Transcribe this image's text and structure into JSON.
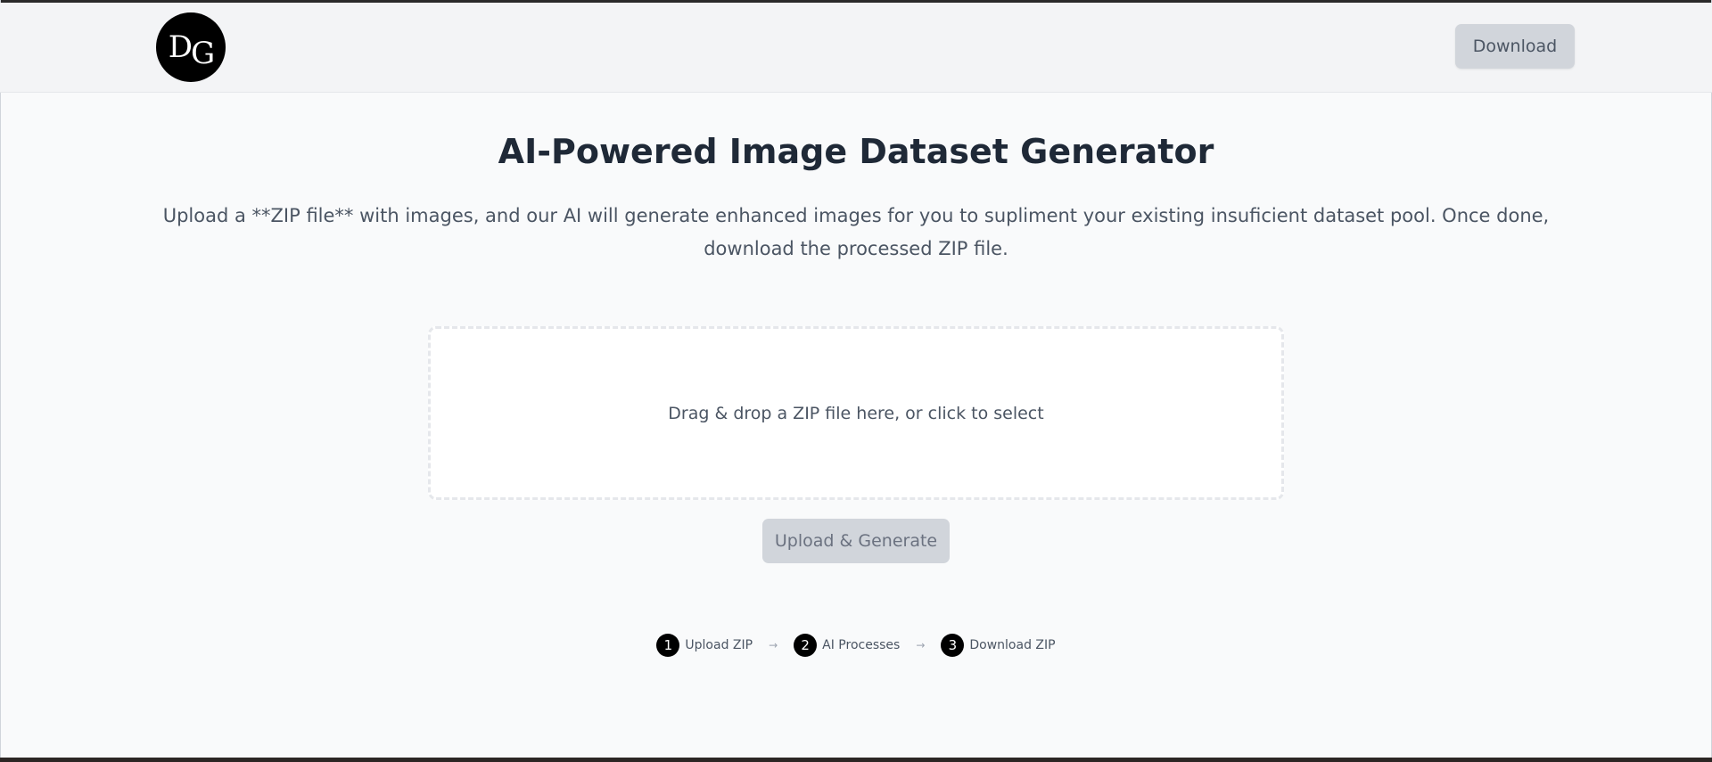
{
  "header": {
    "logo_text": "DG",
    "download_label": "Download"
  },
  "main": {
    "title": "AI-Powered Image Dataset Generator",
    "description": "Upload a **ZIP file** with images, and our AI will generate enhanced images for you to supliment your existing insuficient dataset pool. Once done, download the processed ZIP file.",
    "dropzone_text": "Drag & drop a ZIP file here, or click to select",
    "upload_button": "Upload & Generate"
  },
  "steps": [
    {
      "number": "1",
      "label": "Upload ZIP"
    },
    {
      "number": "2",
      "label": "AI Processes"
    },
    {
      "number": "3",
      "label": "Download ZIP"
    }
  ],
  "step_arrow": "→",
  "colors": {
    "background": "#f9fafb",
    "header_bg": "#f3f4f6",
    "button_bg": "#d1d5db",
    "logo_bg": "#000000"
  }
}
